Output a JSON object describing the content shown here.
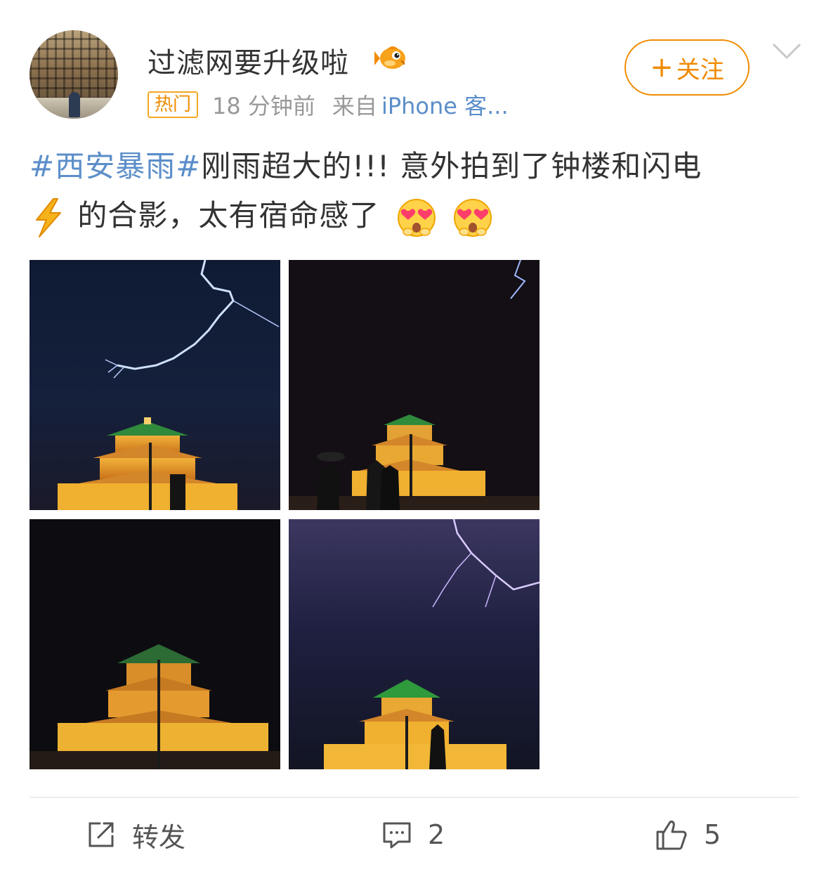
{
  "post": {
    "username": "过滤网要升级啦",
    "badge": "热门",
    "time": "18 分钟前",
    "source_label": "来自",
    "source": "iPhone 客...",
    "follow_label": "关注",
    "follow_plus": "+",
    "hashtag": "#西安暴雨#",
    "text_part1": "刚雨超大的!!! 意外拍到了钟楼和闪电",
    "text_part2": "的合影，太有宿命感了",
    "icons": {
      "verified": "fish-emoji-icon",
      "lightning": "lightning-emoji-icon",
      "love": "heart-eyes-emoji-icon"
    }
  },
  "photos": [
    {
      "name": "clock-tower-lightning-photo"
    },
    {
      "name": "clock-tower-crowd-photo"
    },
    {
      "name": "clock-tower-night-photo"
    },
    {
      "name": "clock-tower-purple-lightning-photo"
    }
  ],
  "actions": {
    "repost_label": "转发",
    "comment_count": "2",
    "like_count": "5"
  },
  "colors": {
    "accent": "#f08b00",
    "link": "#5b8ec9",
    "text": "#333333",
    "meta": "#999999"
  }
}
